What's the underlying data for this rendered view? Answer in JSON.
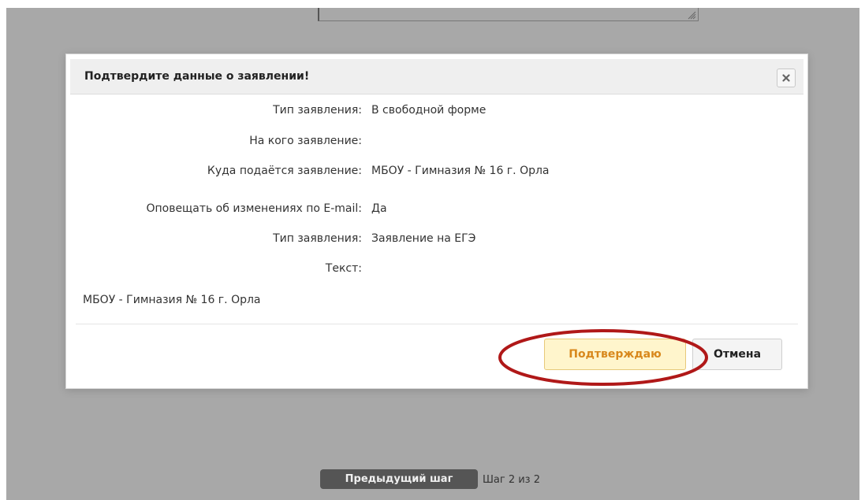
{
  "dialog": {
    "title": "Подтвердите данные о заявлении!",
    "close_icon": "close-icon",
    "fields": [
      {
        "label": "Тип заявления:",
        "value": "В свободной форме"
      },
      {
        "label": "На кого заявление:",
        "value": ""
      },
      {
        "label": "Куда подаётся заявление:",
        "value": "МБОУ - Гимназия № 16 г. Орла"
      },
      {
        "label": "Оповещать об изменениях по E-mail:",
        "value": "Да"
      },
      {
        "label": "Тип заявления:",
        "value": "Заявление на ЕГЭ"
      },
      {
        "label": "Текст:",
        "value": ""
      }
    ],
    "text_content": "МБОУ - Гимназия № 16 г. Орла",
    "confirm_label": "Подтверждаю",
    "cancel_label": "Отмена"
  },
  "wizard": {
    "prev_label": "Предыдущий шаг",
    "step_text": "Шаг 2 из 2"
  },
  "colors": {
    "overlay": "#a8a8a8",
    "confirm_text": "#d8881c",
    "confirm_bg": "#fff5cc",
    "highlight_ring": "#b01818"
  }
}
